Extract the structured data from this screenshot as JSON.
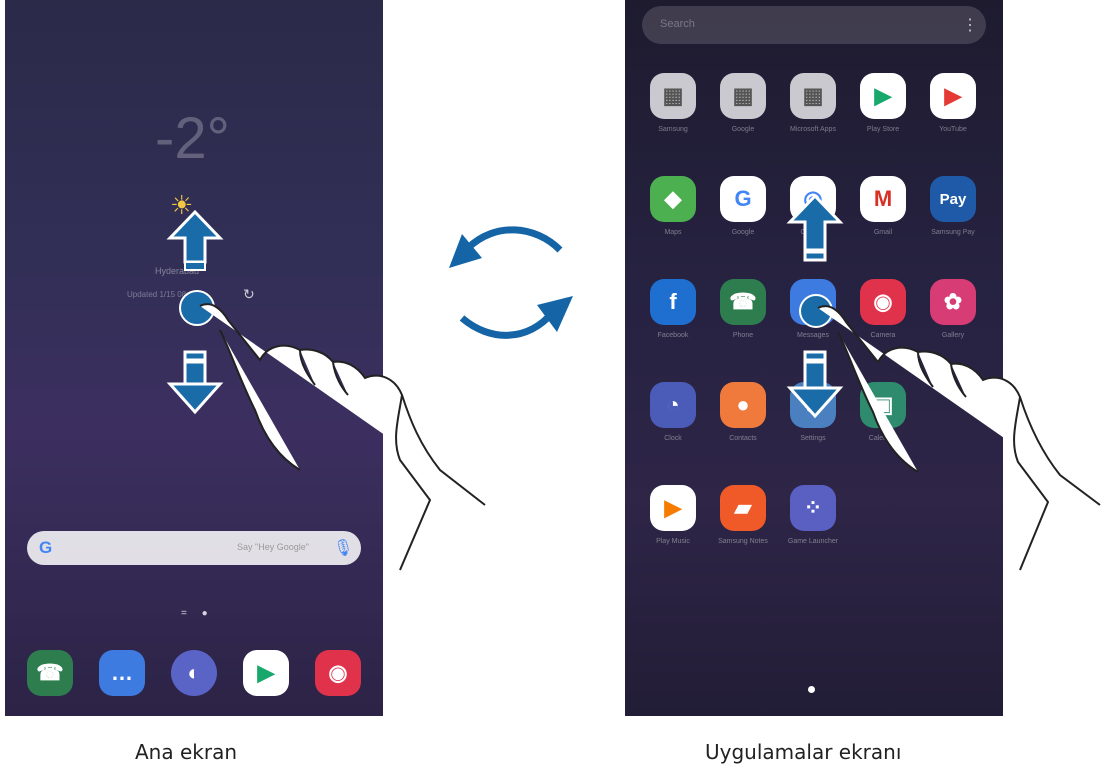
{
  "home_screen": {
    "caption": "Ana ekran",
    "weather": {
      "temperature": "-2°",
      "location": "Hyderabad",
      "updated": "Updated 1/15 08:11"
    },
    "google_search": {
      "logo": "G",
      "hint": "Say \"Hey Google\""
    },
    "pager": "= ●",
    "dock": [
      {
        "name": "Phone",
        "icon": "phone-icon",
        "color": "#2e7d4f"
      },
      {
        "name": "Messages",
        "icon": "message-icon",
        "color": "#3d7be0"
      },
      {
        "name": "Internet",
        "icon": "internet-icon",
        "color": "#5a63c6"
      },
      {
        "name": "Play Store",
        "icon": "play-store-icon",
        "color": "#ffffff"
      },
      {
        "name": "Camera",
        "icon": "camera-icon",
        "color": "#e0324b"
      }
    ]
  },
  "apps_screen": {
    "caption": "Uygulamalar ekranı",
    "search_placeholder": "Search",
    "apps": [
      {
        "label": "Samsung",
        "icon": "folder-icon",
        "color": "#c9c9cf"
      },
      {
        "label": "Google",
        "icon": "folder-icon",
        "color": "#c9c9cf"
      },
      {
        "label": "Microsoft Apps",
        "icon": "folder-icon",
        "color": "#c9c9cf"
      },
      {
        "label": "Play Store",
        "icon": "play-store-icon",
        "color": "#ffffff"
      },
      {
        "label": "YouTube",
        "icon": "youtube-icon",
        "color": "#ffffff"
      },
      {
        "label": "Maps",
        "icon": "maps-icon",
        "color": "#4caf50"
      },
      {
        "label": "Google",
        "icon": "google-icon",
        "color": "#ffffff"
      },
      {
        "label": "Chrome",
        "icon": "chrome-icon",
        "color": "#ffffff"
      },
      {
        "label": "Gmail",
        "icon": "gmail-icon",
        "color": "#ffffff"
      },
      {
        "label": "Samsung Pay",
        "icon": "pay-icon",
        "color": "#1e5aa8"
      },
      {
        "label": "Facebook",
        "icon": "facebook-icon",
        "color": "#1f6fd1"
      },
      {
        "label": "Phone",
        "icon": "phone-icon",
        "color": "#2e7d4f"
      },
      {
        "label": "Messages",
        "icon": "message-icon",
        "color": "#3d7be0"
      },
      {
        "label": "Camera",
        "icon": "camera-icon",
        "color": "#e0324b"
      },
      {
        "label": "Gallery",
        "icon": "gallery-icon",
        "color": "#d83c75"
      },
      {
        "label": "Clock",
        "icon": "clock-icon",
        "color": "#4b5bb8"
      },
      {
        "label": "Contacts",
        "icon": "contacts-icon",
        "color": "#f07a3c"
      },
      {
        "label": "Settings",
        "icon": "settings-icon",
        "color": "#4a7fc0"
      },
      {
        "label": "Calendar",
        "icon": "calendar-icon",
        "color": "#2e8b6e"
      },
      {
        "label": "",
        "icon": "",
        "color": ""
      },
      {
        "label": "Play Music",
        "icon": "play-music-icon",
        "color": "#ffffff"
      },
      {
        "label": "Samsung Notes",
        "icon": "notes-icon",
        "color": "#f05a28"
      },
      {
        "label": "Game Launcher",
        "icon": "game-launcher-icon",
        "color": "#5a5fc2"
      }
    ]
  },
  "icon_glyphs": {
    "phone": "☎",
    "message": "…",
    "internet": "●",
    "camera": "◉",
    "gallery": "✿",
    "clock": "◔",
    "contacts": "●",
    "settings": "⚙",
    "facebook": "f",
    "google": "G",
    "chrome": "◎",
    "gmail": "M",
    "pay": "Pay",
    "youtube": "▶",
    "play": "▶",
    "notes": "▰",
    "game": "⁘",
    "maps": "◆",
    "folder": "▦"
  },
  "colors": {
    "arrow_blue": "#1a6ca8",
    "cycle_blue": "#1565a6"
  }
}
